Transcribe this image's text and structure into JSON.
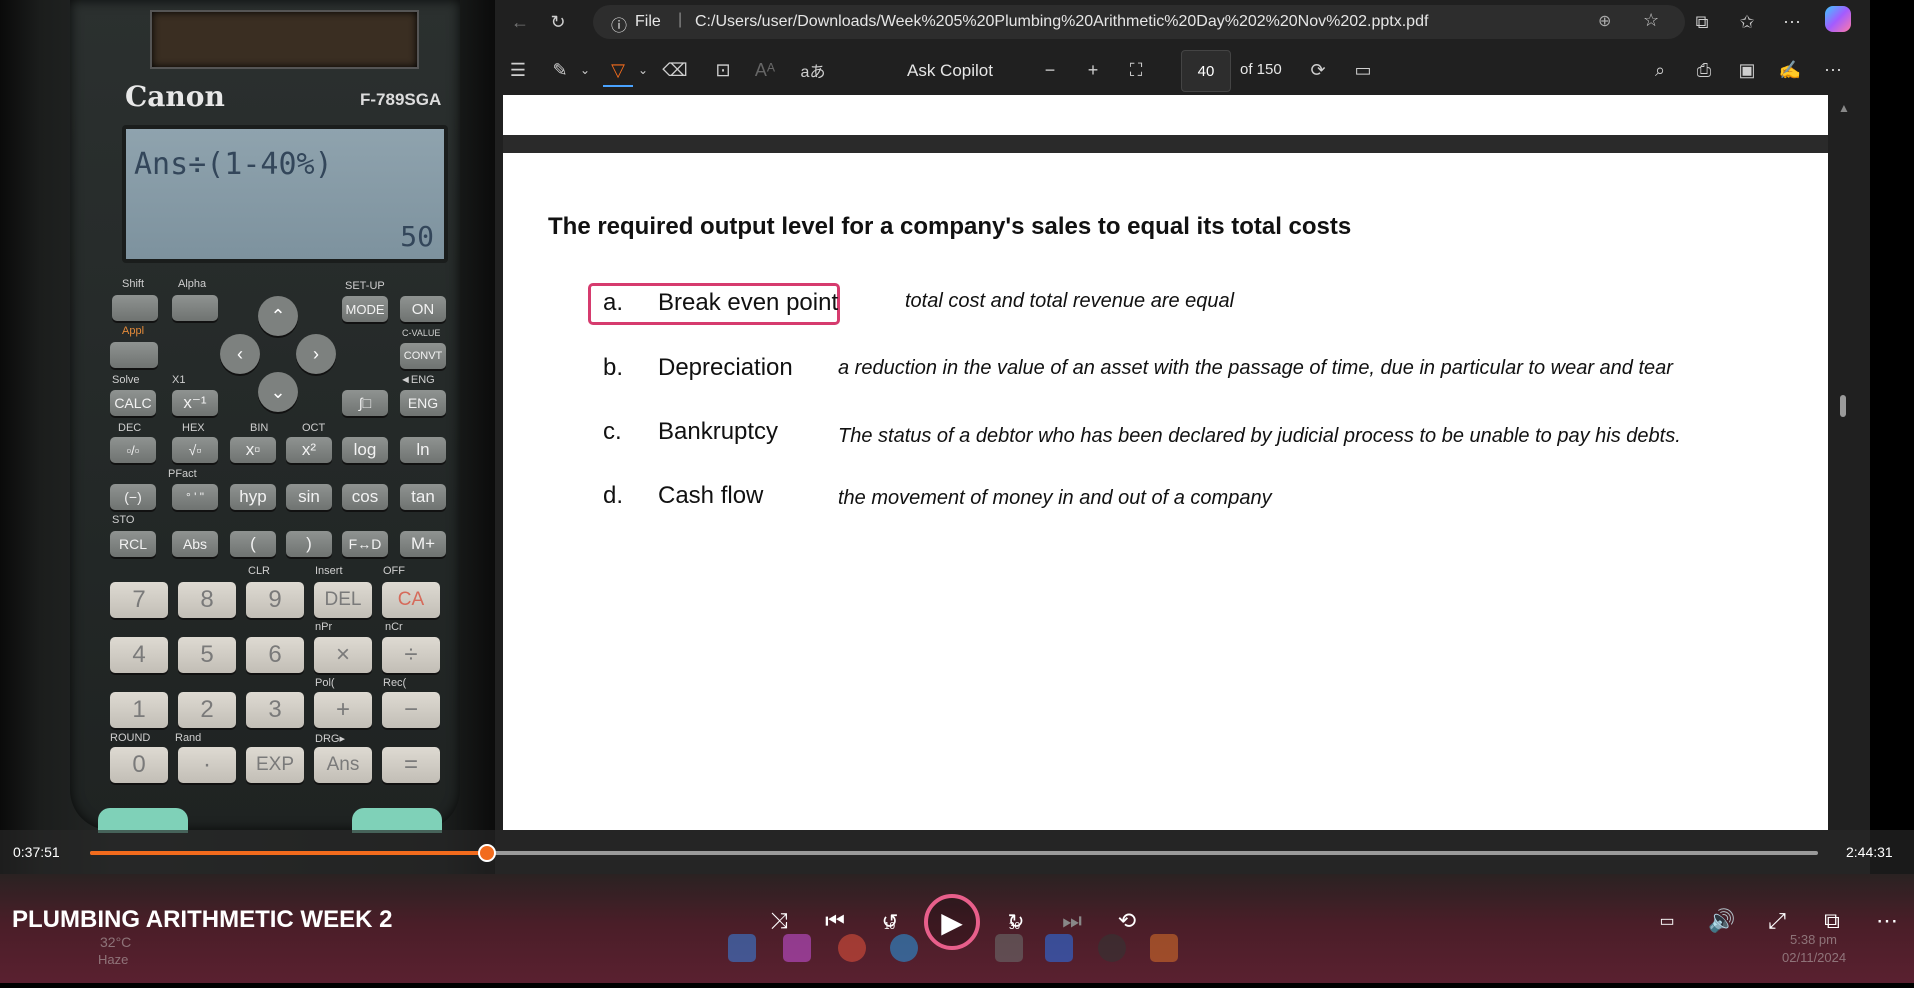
{
  "calculator": {
    "brand": "Canon",
    "model": "F-789SGA",
    "display_expression": "Ans÷(1-40%)",
    "display_result": "50",
    "row_labels": {
      "shift": "Shift",
      "alpha": "Alpha",
      "setup": "SET-UP",
      "cvalue": "C-VALUE",
      "appl": "Appl",
      "solve": "Solve",
      "x1": "X1",
      "eng_label": "◄ENG",
      "dec": "DEC",
      "hex": "HEX",
      "bin": "BIN",
      "oct": "OCT",
      "pfact": "PFact",
      "sto": "STO",
      "clr": "CLR",
      "insert": "Insert",
      "off": "OFF",
      "npr": "nPr",
      "ncr": "nCr",
      "pol": "Pol(",
      "rec": "Rec(",
      "round": "ROUND",
      "rand": "Rand",
      "drg": "DRG▸"
    },
    "keys": {
      "mode": "MODE",
      "on": "ON",
      "convt": "CONVT",
      "calc": "CALC",
      "inverse": "x⁻¹",
      "integral": "∫□",
      "eng": "ENG",
      "frac": "▫/▫",
      "sqrt": "√▫",
      "pow": "x▫",
      "square": "x²",
      "log": "log",
      "ln": "ln",
      "neg": "(−)",
      "dms": "° ' \"",
      "hyp": "hyp",
      "sin": "sin",
      "cos": "cos",
      "tan": "tan",
      "rcl": "RCL",
      "abs": "Abs",
      "lparen": "(",
      "rparen": ")",
      "fd": "F↔D",
      "mplus": "M+",
      "k7": "7",
      "k8": "8",
      "k9": "9",
      "del": "DEL",
      "ca": "CA",
      "k4": "4",
      "k5": "5",
      "k6": "6",
      "mul": "×",
      "div": "÷",
      "k1": "1",
      "k2": "2",
      "k3": "3",
      "plus": "+",
      "minus": "−",
      "k0": "0",
      "dot": "·",
      "exp": "EXP",
      "ans": "Ans",
      "equals": "="
    }
  },
  "browser": {
    "address_prefix": "File",
    "url": "C:/Users/user/Downloads/Week%205%20Plumbing%20Arithmetic%20Day%202%20Nov%202.pptx.pdf",
    "toolbar": {
      "read_aloud_label": "aあ",
      "ask_copilot": "Ask Copilot",
      "zoom_out": "−",
      "zoom_in": "+",
      "page_number": "40",
      "page_total": "of 150"
    }
  },
  "slide": {
    "question": "The required output level for a company's sales to equal its total costs",
    "options": [
      {
        "letter": "a.",
        "term": "Break even point",
        "description": "total cost and total revenue are equal"
      },
      {
        "letter": "b.",
        "term": "Depreciation",
        "description": "a reduction in the value of an asset with the passage of time, due in particular to wear and tear"
      },
      {
        "letter": "c.",
        "term": "Bankruptcy",
        "description": "The status of a debtor who has been declared by judicial process to be unable to pay his debts."
      },
      {
        "letter": "d.",
        "term": "Cash flow",
        "description": "the movement of money in and out of a company"
      }
    ],
    "highlighted_option": "a."
  },
  "player": {
    "elapsed": "0:37:51",
    "duration": "2:44:31",
    "progress_fraction": 0.23,
    "title": "PLUMBING ARITHMETIC WEEK 2",
    "skip_back_label": "10",
    "skip_forward_label": "30",
    "accent_color": "#f26b1d"
  },
  "taskbar_ghost": {
    "weather_temp": "32°C",
    "weather_desc": "Haze",
    "time": "5:38 pm",
    "date": "02/11/2024"
  }
}
